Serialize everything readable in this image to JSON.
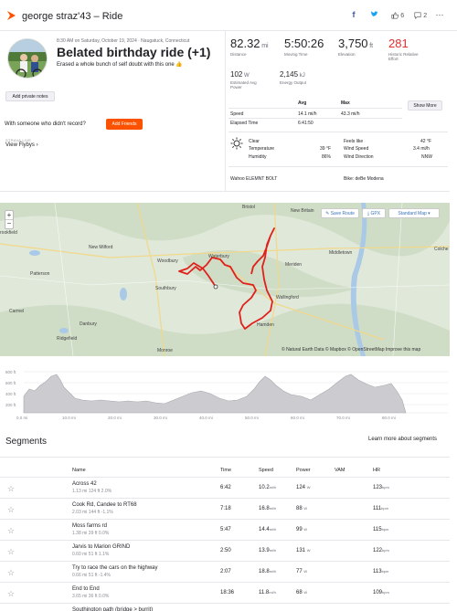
{
  "header": {
    "title": "george straz'43 – Ride",
    "facebook": "f",
    "twitter": "t",
    "kudos_count": "6",
    "comments_count": "2"
  },
  "activity": {
    "date_location": "8:30 AM on Saturday, October 19, 2024 · Naugatuck, Connecticut",
    "title": "Belated birthday ride (+1)",
    "description": "Erased a whole bunch of self doubt with this one 👍",
    "add_notes": "Add private notes",
    "someone_prompt": "With someone who didn't record?",
    "add_friends": "Add Friends",
    "strava_live": "STRAVA LIVE",
    "view_flybys": "View Flybys ›"
  },
  "stats": {
    "distance": {
      "value": "82.32",
      "unit": "mi",
      "label": "Distance"
    },
    "moving_time": {
      "value": "5:50:26",
      "label": "Moving Time"
    },
    "elevation": {
      "value": "3,750",
      "unit": "ft",
      "label": "Elevation"
    },
    "relative_effort": {
      "value": "281",
      "label": "Historic Relative Effort"
    },
    "power": {
      "value": "102",
      "unit": "W",
      "label": "Estimated Avg Power"
    },
    "energy": {
      "value": "2,145",
      "unit": "kJ",
      "label": "Energy Output"
    },
    "table": {
      "avg_header": "Avg",
      "max_header": "Max",
      "speed_label": "Speed",
      "speed_avg": "14.1 mi/h",
      "speed_max": "43.3 mi/h",
      "elapsed_label": "Elapsed Time",
      "elapsed_value": "6:41:50",
      "show_more": "Show More"
    },
    "weather": {
      "condition": "Clear",
      "temperature_label": "Temperature",
      "temperature": "39 °F",
      "humidity_label": "Humidity",
      "humidity": "86%",
      "feels_like_label": "Feels like",
      "feels_like": "42 °F",
      "wind_speed_label": "Wind Speed",
      "wind_speed": "3.4 mi/h",
      "wind_dir_label": "Wind Direction",
      "wind_dir": "NNW"
    },
    "device": "Wahoo ELEMNT BOLT",
    "bike": "Bike: deBe Modena"
  },
  "map": {
    "save_route": "Save Route",
    "gpx": "GPX",
    "standard_map": "Standard Map ▾",
    "attribution": "© Natural Earth Data © Mapbox © OpenStreetMap Improve this map",
    "towns": [
      "Bristol",
      "New Britain",
      "Middletown",
      "Colche",
      "Waterbury",
      "Woodbury",
      "Southbury",
      "Meriden",
      "Wallingford",
      "Hamden",
      "New Milford",
      "Danbury",
      "Ridgefield",
      "Monroe",
      "Carmel",
      "Patterson",
      "Brookfield",
      "rookfield"
    ]
  },
  "elevation": {
    "y_labels": [
      "800 ft",
      "600 ft",
      "400 ft",
      "200 ft"
    ],
    "x_labels": [
      "0.0 mi",
      "10.0 mi",
      "20.0 mi",
      "30.0 mi",
      "40.0 mi",
      "50.0 mi",
      "60.0 mi",
      "70.0 mi",
      "80.0 mi"
    ]
  },
  "segments": {
    "title": "Segments",
    "learn_more": "Learn more about segments",
    "headers": {
      "name": "Name",
      "time": "Time",
      "speed": "Speed",
      "power": "Power",
      "vam": "VAM",
      "hr": "HR"
    },
    "rows": [
      {
        "name": "Across 42",
        "sub": "1.13 mi   124 ft   2.0%",
        "time": "6:42",
        "speed": "10.2",
        "power": "124",
        "hr": "123"
      },
      {
        "name": "Cook Rd, Candee to RT68",
        "sub": "2.03 mi   144 ft   -1.1%",
        "time": "7:18",
        "speed": "16.8",
        "power": "88",
        "hr": "111"
      },
      {
        "name": "Moss farms rd",
        "sub": "1.38 mi   39 ft   0.0%",
        "time": "5:47",
        "speed": "14.4",
        "power": "99",
        "hr": "115"
      },
      {
        "name": "Jarvis to Marion GRIND",
        "sub": "0.60 mi   51 ft   1.1%",
        "time": "2:50",
        "speed": "13.9",
        "power": "131",
        "hr": "122"
      },
      {
        "name": "Try to race the cars on the highway",
        "sub": "0.66 mi   51 ft   -1.4%",
        "time": "2:07",
        "speed": "18.8",
        "power": "77",
        "hr": "113"
      },
      {
        "name": "End to End",
        "sub": "3.65 mi   36 ft   0.0%",
        "time": "18:36",
        "speed": "11.8",
        "power": "68",
        "hr": "109"
      },
      {
        "name": "Southington path (bridge > burrit)",
        "sub": "",
        "time": "",
        "speed": "",
        "power": "",
        "hr": ""
      }
    ],
    "units": {
      "speed": "mi/h",
      "power": "W",
      "hr": "bpm"
    }
  },
  "colors": {
    "accent": "#fc5200",
    "route": "#e0201b",
    "map_bg": "#dfe8d9",
    "water": "#a9c9e6"
  }
}
